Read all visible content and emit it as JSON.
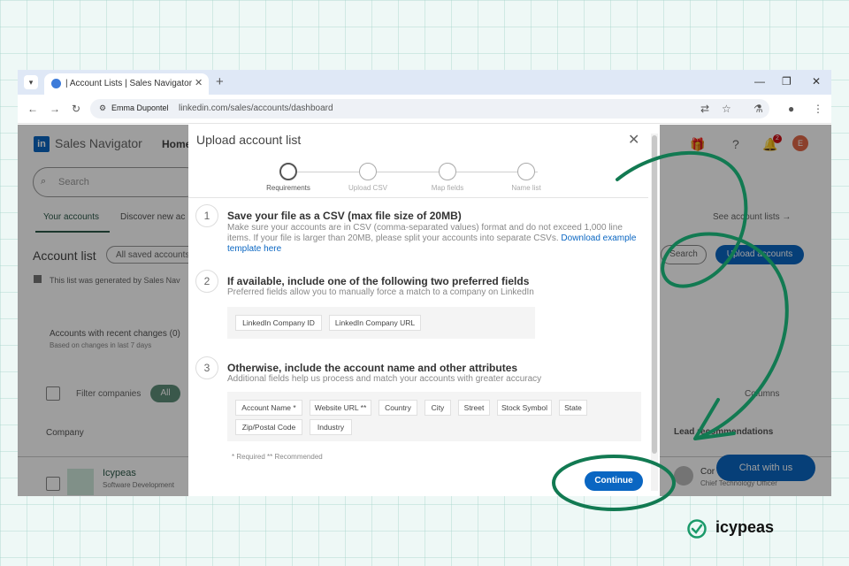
{
  "browser": {
    "tab_title": "| Account Lists | Sales Navigator",
    "site_info_icon": "site-settings-icon",
    "profile_name": "Emma Dupontel",
    "url": "linkedin.com/sales/accounts/dashboard"
  },
  "background_page": {
    "brand": "Sales Navigator",
    "home": "Home",
    "search_placeholder": "Search",
    "tabs": [
      "Your accounts",
      "Discover new ac"
    ],
    "title": "Account list",
    "filter_pill": "All saved accounts",
    "generated_note": "This list was generated by Sales Nav",
    "recent_changes": "Accounts with recent changes (0)",
    "recent_changes_sub": "Based on changes in last 7 days",
    "filter_companies": "Filter companies",
    "all_label": "All",
    "company_header": "Company",
    "row_name": "Icypeas",
    "row_sub": "Software Development",
    "see_lists": "See account lists →",
    "search_button": "Search",
    "upload_button": "Upload accounts",
    "columns": "Columns",
    "notifications_count": "2",
    "avatar_letter": "E",
    "lead_recs": "Lead recommendations",
    "rec_name": "Cor",
    "rec_title": "Chief Technology Officer",
    "chat": "Chat with us"
  },
  "modal": {
    "title": "Upload account list",
    "steps": [
      "Requirements",
      "Upload CSV",
      "Map fields",
      "Name list"
    ],
    "sections": [
      {
        "num": "1",
        "title": "Save your file as a CSV (max file size of 20MB)",
        "desc": "Make sure your accounts are in CSV (comma-separated values) format and do not exceed 1,000 line items. If your file is larger than 20MB, please split your accounts into separate CSVs.",
        "link": "Download example template here"
      },
      {
        "num": "2",
        "title": "If available, include one of the following two preferred fields",
        "desc": "Preferred fields allow you to manually force a match to a company on LinkedIn",
        "chips": [
          "LinkedIn Company ID",
          "LinkedIn Company URL"
        ]
      },
      {
        "num": "3",
        "title": "Otherwise, include the account name and other attributes",
        "desc": "Additional fields help us process and match your accounts with greater accuracy",
        "chips": [
          "Account Name *",
          "Website URL **",
          "Country",
          "City",
          "Street",
          "Stock Symbol",
          "State",
          "Zip/Postal Code",
          "Industry"
        ]
      }
    ],
    "footnote": "* Required    ** Recommended",
    "continue": "Continue"
  },
  "branding": {
    "name": "icypeas"
  },
  "colors": {
    "linkedin_blue": "#0a66c2",
    "annotation_green": "#127a52"
  }
}
